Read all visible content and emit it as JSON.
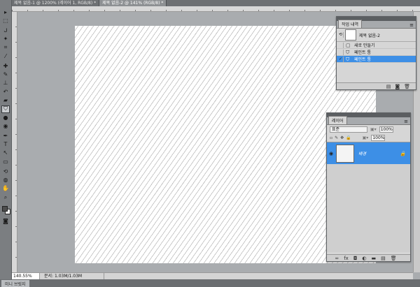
{
  "document_tabs": [
    {
      "label": "제목 없음-1 @ 1200% (레이어 1, RGB/8) *",
      "active": false
    },
    {
      "label": "제목 없음-2 @ 141% (RGB/8) *",
      "active": true
    }
  ],
  "toolbar": {
    "tools": [
      {
        "icon": "move-icon",
        "glyph": "▸"
      },
      {
        "icon": "marquee-icon",
        "glyph": "⬚"
      },
      {
        "icon": "lasso-icon",
        "glyph": "ᒍ"
      },
      {
        "icon": "magic-wand-icon",
        "glyph": "✦"
      },
      {
        "icon": "crop-icon",
        "glyph": "⌗"
      },
      {
        "icon": "eyedropper-icon",
        "glyph": "⁄"
      },
      {
        "icon": "healing-brush-icon",
        "glyph": "✚"
      },
      {
        "icon": "brush-icon",
        "glyph": "✎"
      },
      {
        "icon": "clone-stamp-icon",
        "glyph": "⊥"
      },
      {
        "icon": "history-brush-icon",
        "glyph": "↶"
      },
      {
        "icon": "eraser-icon",
        "glyph": "▰"
      },
      {
        "icon": "paint-bucket-icon",
        "glyph": "⛉"
      },
      {
        "icon": "blur-icon",
        "glyph": "●"
      },
      {
        "icon": "dodge-icon",
        "glyph": "◉"
      },
      {
        "icon": "pen-icon",
        "glyph": "✒"
      },
      {
        "icon": "type-icon",
        "glyph": "T"
      },
      {
        "icon": "path-selection-icon",
        "glyph": "↖"
      },
      {
        "icon": "shape-icon",
        "glyph": "▭"
      },
      {
        "icon": "3d-rotate-icon",
        "glyph": "⟲"
      },
      {
        "icon": "3d-orbit-icon",
        "glyph": "◍"
      },
      {
        "icon": "hand-icon",
        "glyph": "✋"
      },
      {
        "icon": "zoom-icon",
        "glyph": "⌕"
      }
    ],
    "active_tool": "paint-bucket-icon",
    "foreground_color": "#4d4d4d",
    "background_color": "#ffffff"
  },
  "status": {
    "zoom": "140.55%",
    "doc_size": "문서: 1.03M/1.03M"
  },
  "bottom_tab": "미니 브릿지",
  "history": {
    "tab": "작업 내역",
    "snapshot": "제목 없음-2",
    "items": [
      {
        "label": "새로 만들기",
        "icon": "new-document-icon",
        "selected": false
      },
      {
        "label": "페인트 통",
        "icon": "paint-bucket-icon",
        "selected": false
      },
      {
        "label": "페인트 통",
        "icon": "paint-bucket-icon",
        "selected": true
      }
    ]
  },
  "layers": {
    "tab": "레이어",
    "blend_mode": "표준",
    "opacity": "100%",
    "fill": "100%",
    "layer": {
      "name": "배경",
      "selected": true
    }
  },
  "colors": {
    "selection": "#3d8fe6",
    "workspace": "#a9acaf"
  }
}
